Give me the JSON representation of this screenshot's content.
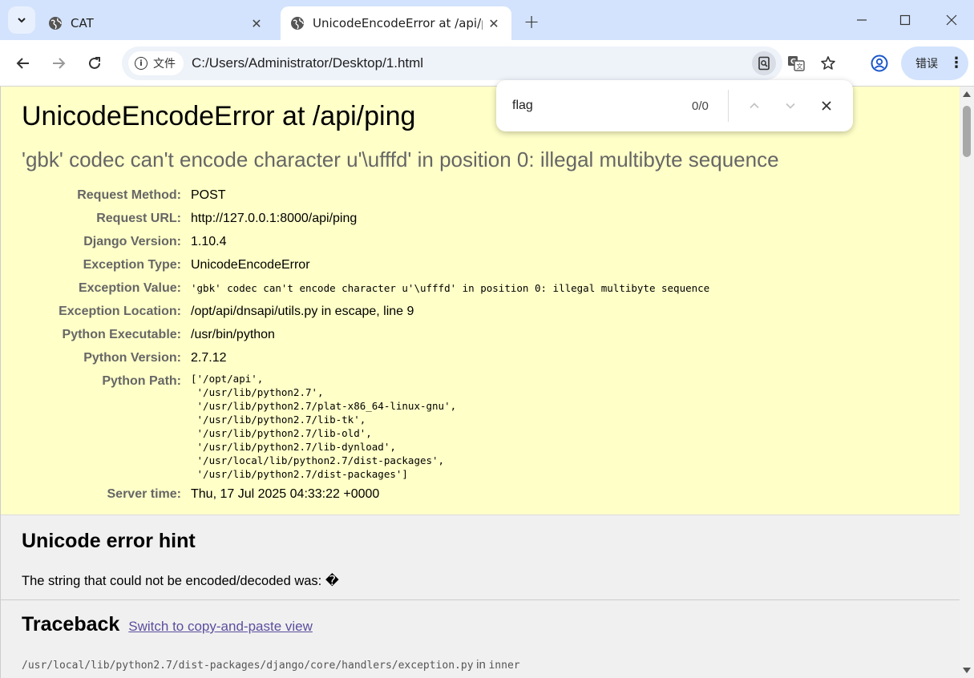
{
  "tabs": [
    {
      "label": "CAT",
      "active": false
    },
    {
      "label": "UnicodeEncodeError at /api/ping",
      "active": true
    }
  ],
  "toolbar": {
    "chip_label": "文件",
    "url": "C:/Users/Administrator/Desktop/1.html",
    "error_label": "错误"
  },
  "find": {
    "query": "flag",
    "count": "0/0"
  },
  "error": {
    "title": "UnicodeEncodeError at /api/ping",
    "subtitle": "'gbk' codec can't encode character u'\\ufffd' in position 0: illegal multibyte sequence"
  },
  "meta": [
    {
      "label": "Request Method:",
      "value": "POST"
    },
    {
      "label": "Request URL:",
      "value": "http://127.0.0.1:8000/api/ping"
    },
    {
      "label": "Django Version:",
      "value": "1.10.4"
    },
    {
      "label": "Exception Type:",
      "value": "UnicodeEncodeError"
    },
    {
      "label": "Exception Value:",
      "value": "'gbk' codec can't encode character u'\\ufffd' in position 0: illegal multibyte sequence"
    },
    {
      "label": "Exception Location:",
      "value": "/opt/api/dnsapi/utils.py in escape, line 9"
    },
    {
      "label": "Python Executable:",
      "value": "/usr/bin/python"
    },
    {
      "label": "Python Version:",
      "value": "2.7.12"
    },
    {
      "label": "Python Path:",
      "value": ""
    },
    {
      "label": "Server time:",
      "value": "Thu, 17 Jul 2025 04:33:22 +0000"
    }
  ],
  "python_path": "['/opt/api',\n '/usr/lib/python2.7',\n '/usr/lib/python2.7/plat-x86_64-linux-gnu',\n '/usr/lib/python2.7/lib-tk',\n '/usr/lib/python2.7/lib-old',\n '/usr/lib/python2.7/lib-dynload',\n '/usr/local/lib/python2.7/dist-packages',\n '/usr/lib/python2.7/dist-packages']",
  "hint": {
    "title": "Unicode error hint",
    "text": "The string that could not be encoded/decoded was: �"
  },
  "traceback": {
    "title": "Traceback",
    "link": "Switch to copy-and-paste view",
    "frame_file": "/usr/local/lib/python2.7/dist-packages/django/core/handlers/exception.py",
    "frame_in": "in",
    "frame_func": "inner"
  },
  "colors": {
    "summary_bg": "#ffffc8",
    "tabstrip_bg": "#d3e3fd",
    "link": "#5b4f9e"
  }
}
